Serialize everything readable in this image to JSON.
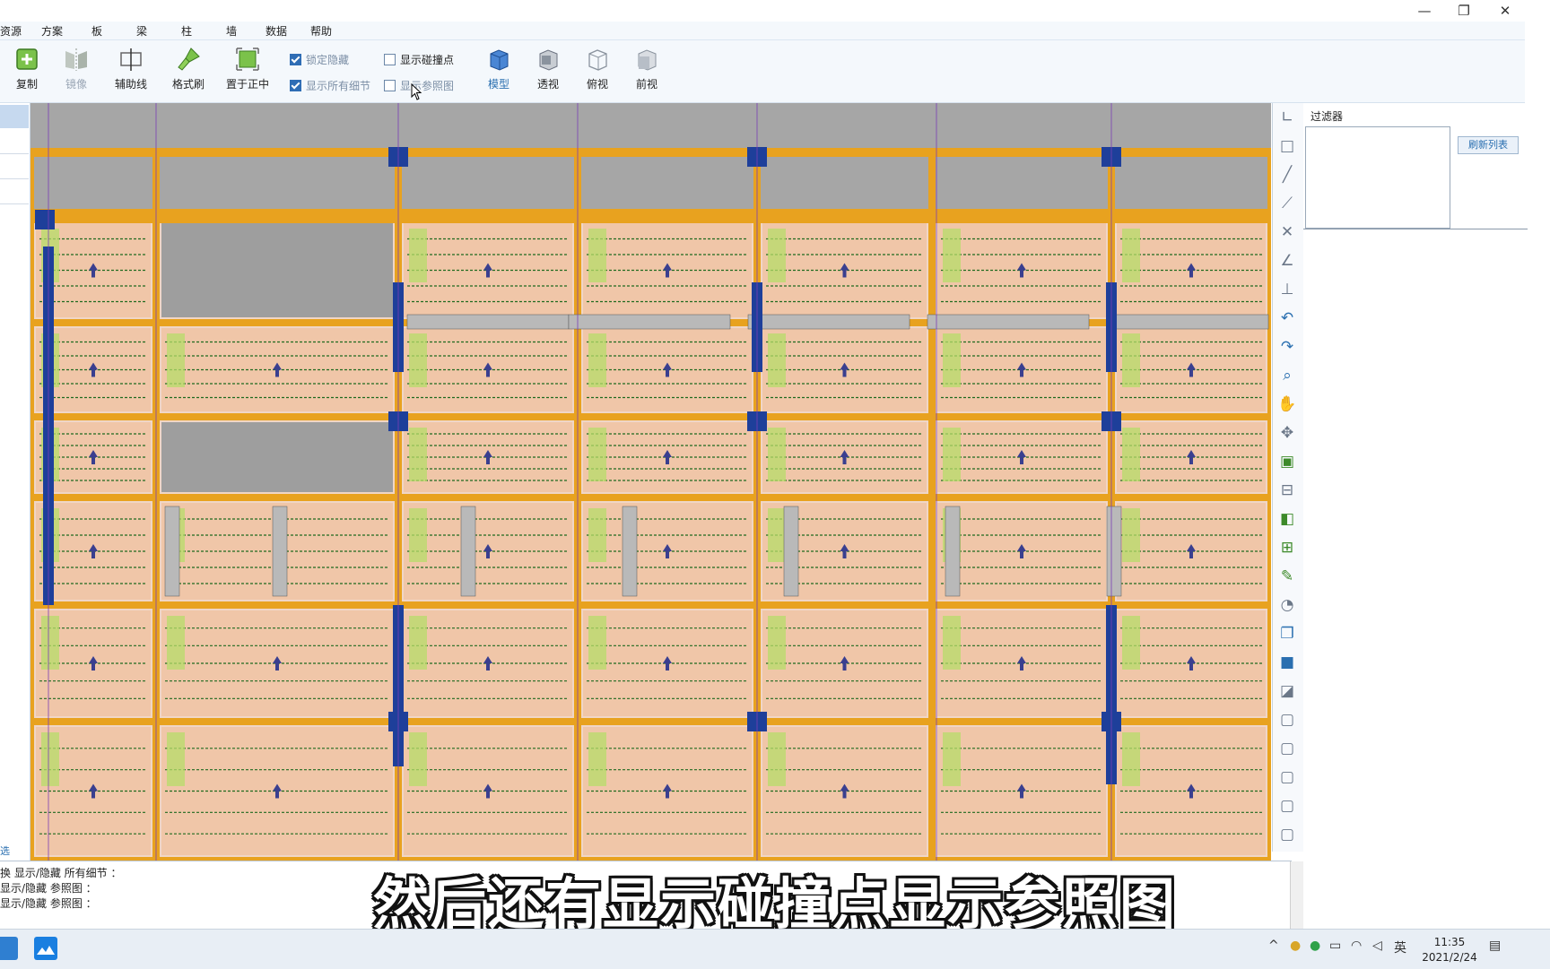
{
  "window": {
    "controls": {
      "minimize": "—",
      "maximize": "❐",
      "close": "✕"
    }
  },
  "menu": {
    "items": [
      "资源",
      "方案",
      "板",
      "梁",
      "柱",
      "墙",
      "数据",
      "帮助"
    ]
  },
  "toolbar": {
    "buttons": [
      {
        "label": "复制",
        "icon": "copy-icon",
        "state": "normal"
      },
      {
        "label": "镜像",
        "icon": "mirror-icon",
        "state": "disabled"
      },
      {
        "label": "辅助线",
        "icon": "guide-line-icon",
        "state": "normal"
      },
      {
        "label": "格式刷",
        "icon": "format-brush-icon",
        "state": "normal"
      },
      {
        "label": "置于正中",
        "icon": "center-icon",
        "state": "normal"
      }
    ],
    "checkboxes": [
      {
        "label": "锁定隐藏",
        "checked": true
      },
      {
        "label": "显示所有细节",
        "checked": true
      },
      {
        "label": "显示碰撞点",
        "checked": false
      },
      {
        "label": "显示参照图",
        "checked": false
      }
    ],
    "views": [
      {
        "label": "模型",
        "icon": "model-view-icon",
        "active": true
      },
      {
        "label": "透视",
        "icon": "perspective-view-icon",
        "active": false
      },
      {
        "label": "俯视",
        "icon": "top-view-icon",
        "active": false
      },
      {
        "label": "前视",
        "icon": "front-view-icon",
        "active": false
      }
    ]
  },
  "left_panel": {
    "tag": "选"
  },
  "filter_panel": {
    "title": "过滤器",
    "refresh_label": "刷新列表"
  },
  "vertical_tools": [
    "axis-icon",
    "rectangle-icon",
    "line-icon",
    "polyline-icon",
    "cross-icon",
    "angle-icon",
    "perpendicular-icon",
    "undo-icon",
    "redo-icon",
    "zoom-icon",
    "pan-hand-icon",
    "rotate-icon",
    "center-icon",
    "guide-line-icon",
    "mirror-icon",
    "copy-icon",
    "format-brush-icon",
    "pie-icon",
    "overlap-icon",
    "cube-front-icon",
    "cube-shadow-icon",
    "cube-wire-icon",
    "cube-grey-icon",
    "cube-grey2-icon",
    "cube-grey3-icon",
    "cube-grey4-icon"
  ],
  "command_output": {
    "lines": [
      "换 显示/隐藏 所有细节 ：",
      "显示/隐藏 参照图 ：",
      "显示/隐藏 参照图 ："
    ]
  },
  "subtitle": "然后还有显示碰撞点显示参照图",
  "taskbar": {
    "tray": [
      "^",
      "英"
    ],
    "time": "11:35",
    "date": "2021/2/24"
  },
  "colors": {
    "slab": "#f0c6a8",
    "beam": "#e8a21f",
    "column": "#1e3f9a",
    "rebar_green": "#1f6a1f",
    "grey_void": "#9a9a9a",
    "grid_purple": "#7b3fb5"
  }
}
